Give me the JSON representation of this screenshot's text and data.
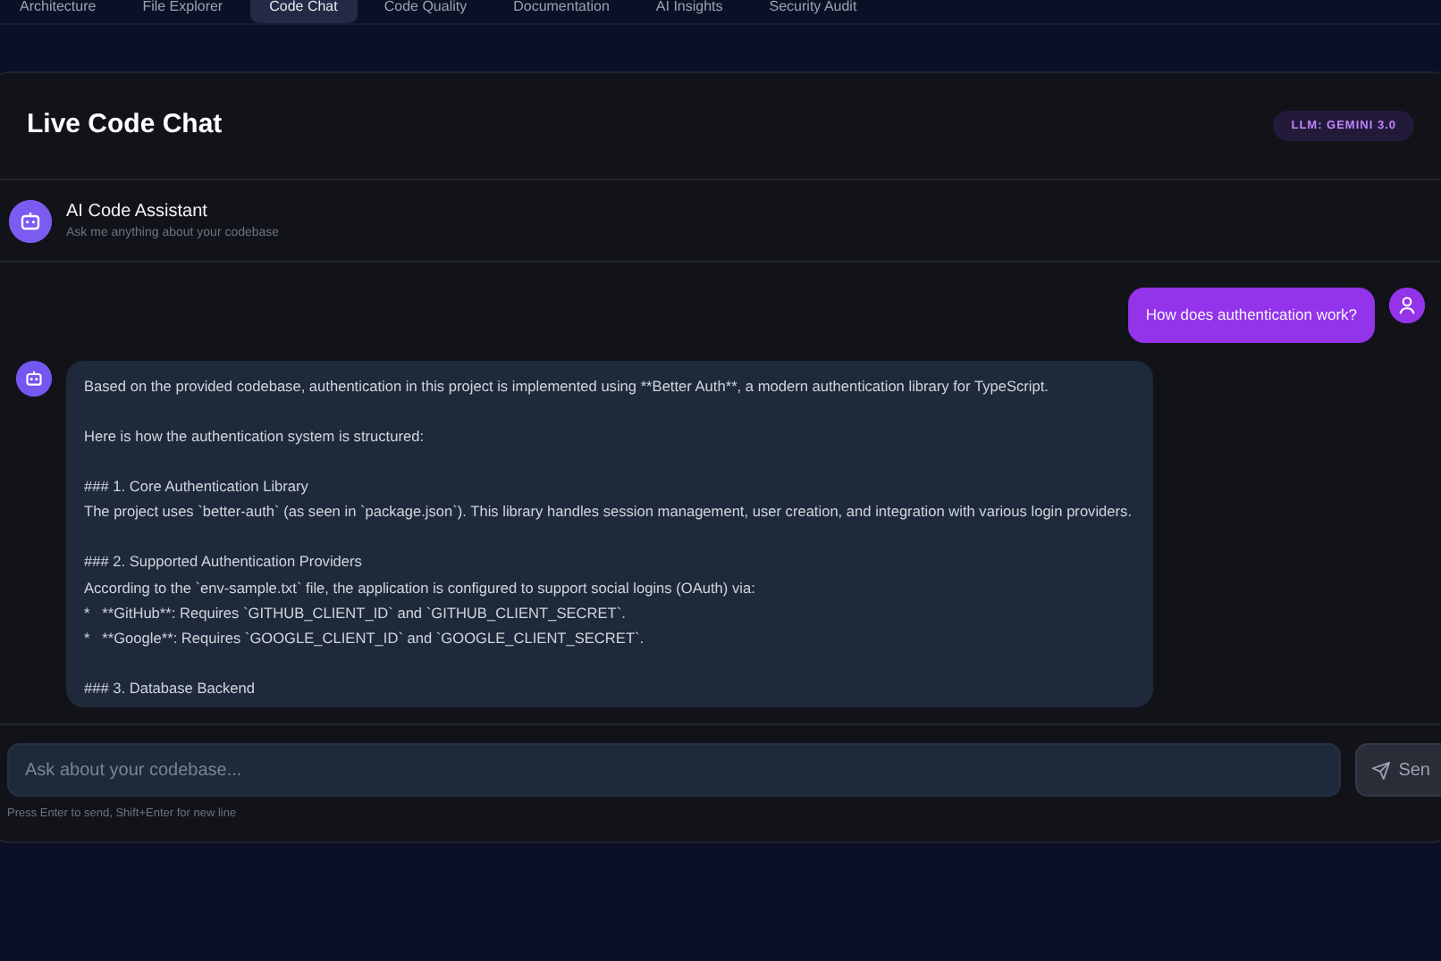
{
  "tabs": [
    {
      "label": "Architecture",
      "selected": false
    },
    {
      "label": "File Explorer",
      "selected": false
    },
    {
      "label": "Code Chat",
      "selected": true
    },
    {
      "label": "Code Quality",
      "selected": false
    },
    {
      "label": "Documentation",
      "selected": false
    },
    {
      "label": "AI Insights",
      "selected": false
    },
    {
      "label": "Security Audit",
      "selected": false
    }
  ],
  "panel": {
    "title": "Live Code Chat",
    "model_badge": "LLM: GEMINI 3.0"
  },
  "assistant": {
    "name": "AI Code Assistant",
    "subtitle": "Ask me anything about your codebase"
  },
  "messages": [
    {
      "kind": "user",
      "text": "How does authentication work?"
    },
    {
      "kind": "assistant",
      "text": "Based on the provided codebase, authentication in this project is implemented using **Better Auth**, a modern authentication library for TypeScript.\n\nHere is how the authentication system is structured:\n\n### 1. Core Authentication Library\nThe project uses `better-auth` (as seen in `package.json`). This library handles session management, user creation, and integration with various login providers.\n\n### 2. Supported Authentication Providers\nAccording to the `env-sample.txt` file, the application is configured to support social logins (OAuth) via:\n*   **GitHub**: Requires `GITHUB_CLIENT_ID` and `GITHUB_CLIENT_SECRET`.\n*   **Google**: Requires `GOOGLE_CLIENT_ID` and `GOOGLE_CLIENT_SECRET`.\n\n### 3. Database Backend"
    }
  ],
  "composer": {
    "placeholder": "Ask about your codebase...",
    "send_label": "Sen",
    "hint": "Press Enter to send, Shift+Enter for new line"
  }
}
